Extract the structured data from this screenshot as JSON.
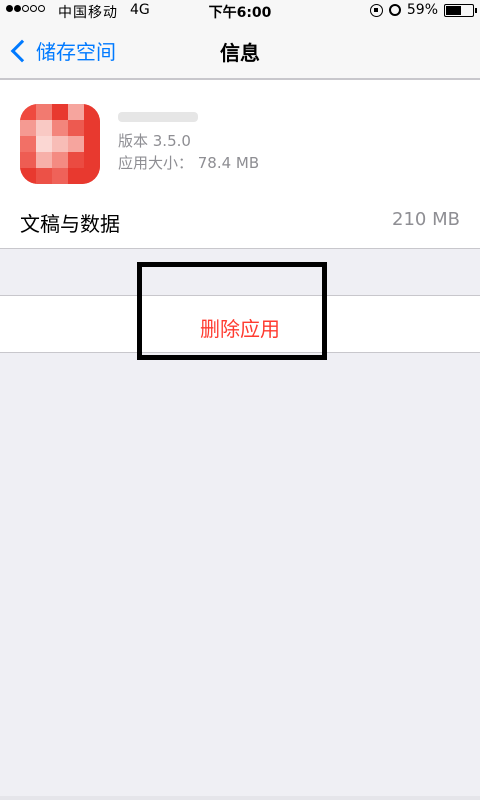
{
  "status_bar": {
    "carrier": "中国移动",
    "network": "4G",
    "time": "下午6:00",
    "battery_percent": "59%",
    "battery_level": 0.59
  },
  "nav": {
    "back_label": "储存空间",
    "title": "信息"
  },
  "app": {
    "version": "版本 3.5.0",
    "size": "应用大小：  78.4 MB",
    "icon_color": "#e8392f"
  },
  "docs_row": {
    "label": "文稿与数据",
    "value": "210 MB"
  },
  "delete": {
    "label": "删除应用",
    "color": "#ff3b30"
  },
  "accent_color": "#007aff"
}
